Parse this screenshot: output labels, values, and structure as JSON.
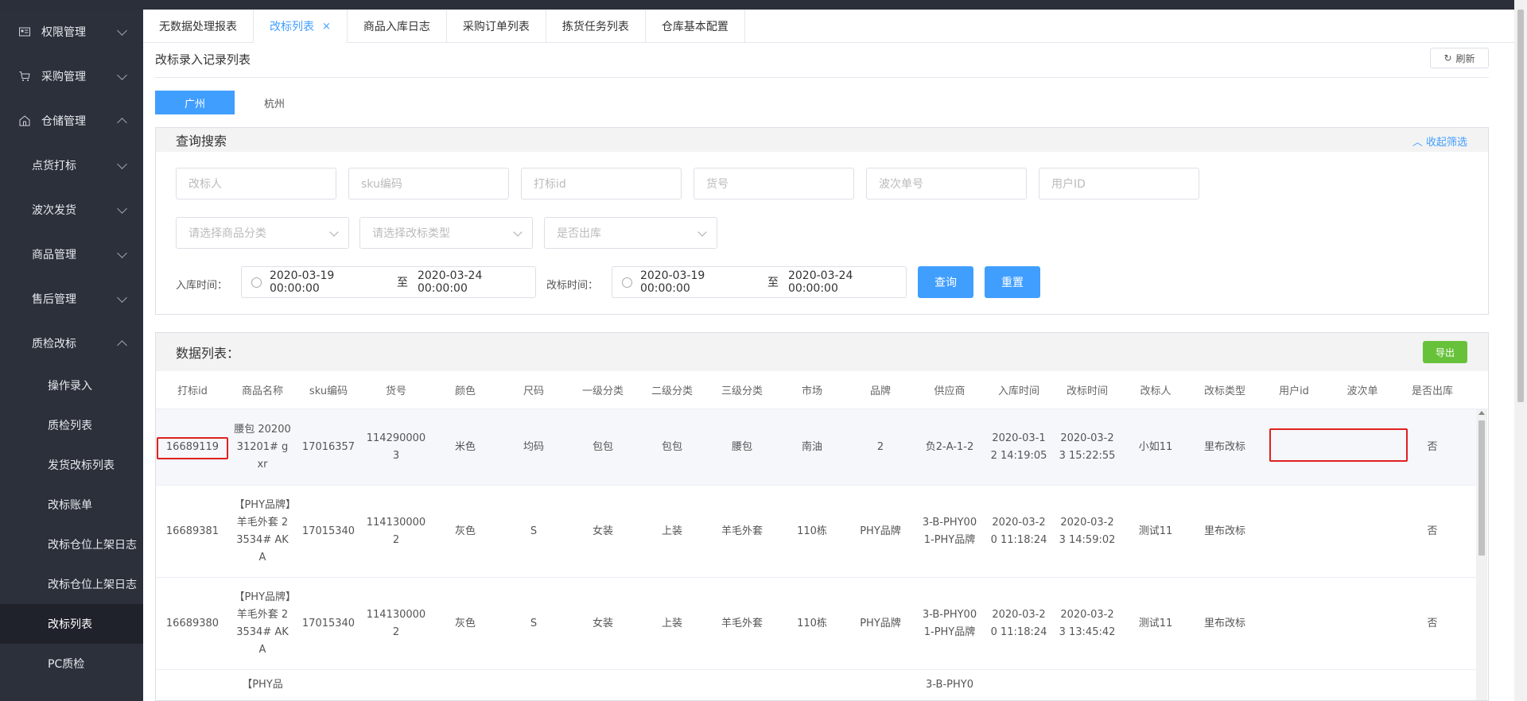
{
  "sidebar": {
    "items": [
      {
        "label": "权限管理"
      },
      {
        "label": "采购管理"
      },
      {
        "label": "仓储管理"
      }
    ],
    "subs": [
      {
        "label": "点货打标"
      },
      {
        "label": "波次发货"
      },
      {
        "label": "商品管理"
      },
      {
        "label": "售后管理"
      },
      {
        "label": "质检改标"
      }
    ],
    "leaves": [
      {
        "label": "操作录入"
      },
      {
        "label": "质检列表"
      },
      {
        "label": "发货改标列表"
      },
      {
        "label": "改标账单"
      },
      {
        "label": "改标仓位上架日志"
      },
      {
        "label": "改标仓位上架日志"
      },
      {
        "label": "改标列表"
      },
      {
        "label": "PC质检"
      }
    ]
  },
  "tabs": [
    {
      "label": "无数据处理报表"
    },
    {
      "label": "改标列表",
      "close": "×"
    },
    {
      "label": "商品入库日志"
    },
    {
      "label": "采购订单列表"
    },
    {
      "label": "拣货任务列表"
    },
    {
      "label": "仓库基本配置"
    }
  ],
  "page": {
    "title": "改标录入记录列表",
    "refresh": "刷新"
  },
  "cities": [
    "广州",
    "杭州"
  ],
  "search": {
    "title": "查询搜索",
    "collapse": "收起筛选",
    "placeholders": {
      "modifier": "改标人",
      "sku": "sku编码",
      "mark_id": "打标id",
      "goods_no": "货号",
      "wave_no": "波次单号",
      "user_id": "用户ID",
      "category": "请选择商品分类",
      "mark_type": "请选择改标类型",
      "out": "是否出库"
    },
    "in_time_label": "入库时间：",
    "mark_time_label": "改标时间：",
    "date_from": "2020-03-19 00:00:00",
    "date_sep": "至",
    "date_to": "2020-03-24 00:00:00",
    "query": "查询",
    "reset": "重置"
  },
  "table": {
    "title": "数据列表：",
    "export": "导出",
    "headers": [
      "打标id",
      "商品名称",
      "sku编码",
      "货号",
      "颜色",
      "尺码",
      "一级分类",
      "二级分类",
      "三级分类",
      "市场",
      "品牌",
      "供应商",
      "入库时间",
      "改标时间",
      "改标人",
      "改标类型",
      "用户id",
      "波次单",
      "是否出库"
    ],
    "rows": [
      [
        "16689119",
        "腰包 2020031201# gxr",
        "17016357",
        "1142900003",
        "米色",
        "均码",
        "包包",
        "包包",
        "腰包",
        "南油",
        "2",
        "负2-A-1-2",
        "2020-03-12 14:19:05",
        "2020-03-23 15:22:55",
        "小如11",
        "里布改标",
        "",
        "",
        "否"
      ],
      [
        "16689381",
        "【PHY品牌】羊毛外套 23534# AKA",
        "17015340",
        "1141300002",
        "灰色",
        "S",
        "女装",
        "上装",
        "羊毛外套",
        "110栋",
        "PHY品牌",
        "3-B-PHY001-PHY品牌",
        "2020-03-20 11:18:24",
        "2020-03-23 14:59:02",
        "测试11",
        "里布改标",
        "",
        "",
        "否"
      ],
      [
        "16689380",
        "【PHY品牌】羊毛外套 23534# AKA",
        "17015340",
        "1141300002",
        "灰色",
        "S",
        "女装",
        "上装",
        "羊毛外套",
        "110栋",
        "PHY品牌",
        "3-B-PHY001-PHY品牌",
        "2020-03-20 11:18:24",
        "2020-03-23 13:45:42",
        "测试11",
        "里布改标",
        "",
        "",
        "否"
      ],
      [
        "",
        "【PHY品",
        "",
        "",
        "",
        "",
        "",
        "",
        "",
        "",
        "",
        "3-B-PHY0",
        "",
        "",
        "",
        "",
        "",
        "",
        ""
      ]
    ]
  }
}
